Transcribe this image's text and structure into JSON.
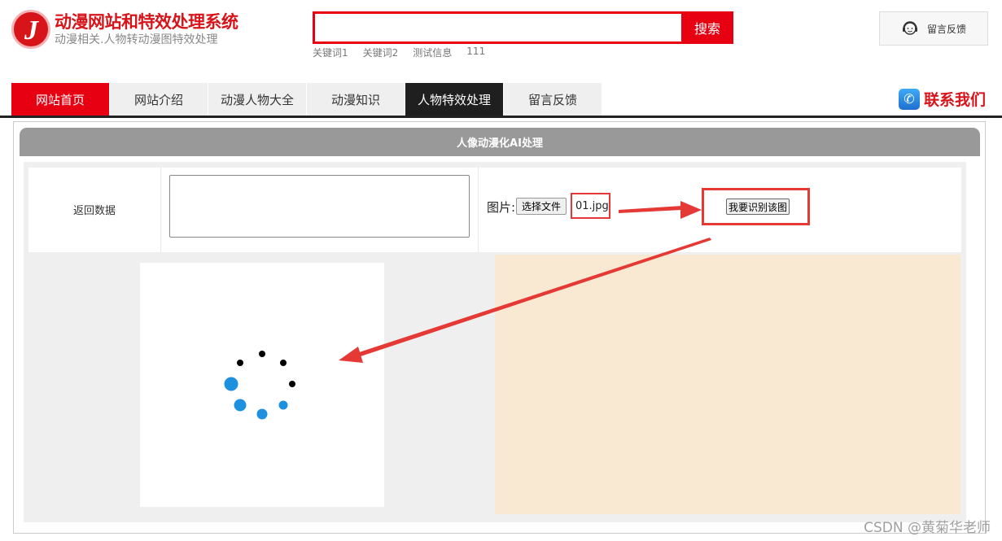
{
  "header": {
    "logo_letter": "J",
    "title": "动漫网站和特效处理系统",
    "subtitle": "动漫相关.人物转动漫图特效处理"
  },
  "search": {
    "placeholder": "",
    "button_label": "搜索",
    "keywords": [
      "关键词1",
      "关键词2",
      "测试信息",
      "111"
    ]
  },
  "feedback_top": {
    "label": "留言反馈",
    "icon": "headset-icon"
  },
  "nav": {
    "items": [
      {
        "label": "网站首页"
      },
      {
        "label": "网站介绍"
      },
      {
        "label": "动漫人物大全"
      },
      {
        "label": "动漫知识"
      },
      {
        "label": "人物特效处理"
      },
      {
        "label": "留言反馈"
      }
    ],
    "home_index": 0,
    "active_index": 4
  },
  "contact": {
    "label": "联系我们",
    "icon": "phone-icon"
  },
  "panel": {
    "title": "人像动漫化AI处理",
    "return_label": "返回数据",
    "textarea_value": "",
    "pic_label": "图片:",
    "choose_file_label": "选择文件",
    "file_name": "01.jpg",
    "recognize_label": "我要识别该图"
  },
  "loading": {
    "icon": "loading-spinner-icon"
  },
  "watermark": "CSDN @黄菊华老师",
  "colors": {
    "brand_red": "#e60012",
    "nav_active": "#1f1f1f",
    "panel_header": "#999999",
    "result_bg": "#f9e9d3",
    "annotation_red": "#e53935",
    "spinner_blue": "#1e90e0"
  }
}
